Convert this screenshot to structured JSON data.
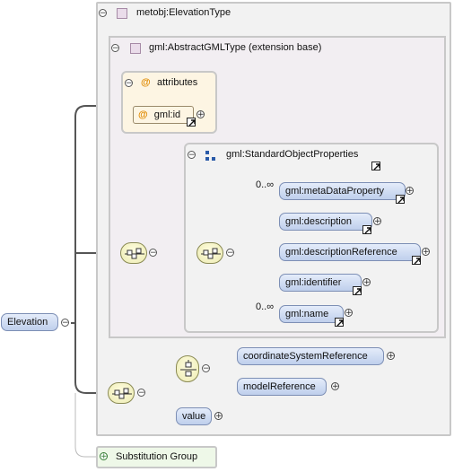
{
  "root": {
    "type_name": "metobj:ElevationType",
    "element_label": "Elevation"
  },
  "extension": {
    "title": "gml:AbstractGMLType (extension base)"
  },
  "attributes": {
    "title": "attributes",
    "items": [
      {
        "label": "gml:id"
      }
    ]
  },
  "group": {
    "title": "gml:StandardObjectProperties",
    "elements": [
      {
        "label": "gml:metaDataProperty",
        "occurs": "0..∞"
      },
      {
        "label": "gml:description",
        "occurs": ""
      },
      {
        "label": "gml:descriptionReference",
        "occurs": ""
      },
      {
        "label": "gml:identifier",
        "occurs": ""
      },
      {
        "label": "gml:name",
        "occurs": "0..∞"
      }
    ]
  },
  "sequence2": {
    "choice_elements": [
      {
        "label": "coordinateSystemReference"
      },
      {
        "label": "modelReference"
      }
    ],
    "value_element": {
      "label": "value"
    }
  },
  "substitution": {
    "label": "Substitution Group"
  },
  "glyphs": {
    "at": "@",
    "minus": "−",
    "plus": "+"
  },
  "icons": {
    "sequence": "sequence-compositor-icon",
    "choice": "choice-compositor-icon",
    "group": "group-icon",
    "reference": "reference-arrow-icon"
  },
  "colors": {
    "element_fill": "#c6d5ef",
    "compositor_fill": "#f3f1c4",
    "attribute_fill": "#fdf5e3",
    "extension_fill": "#f2eef2",
    "substitution_fill": "#eef8e8"
  }
}
